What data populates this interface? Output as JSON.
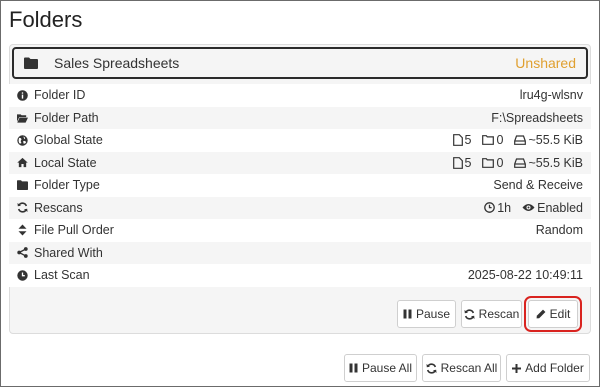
{
  "page": {
    "title": "Folders"
  },
  "folder": {
    "name": "Sales Spreadsheets",
    "status": "Unshared",
    "rows": [
      {
        "label": "Folder ID",
        "value": "lru4g-wlsnv",
        "icon": "info-circle-icon"
      },
      {
        "label": "Folder Path",
        "value": "F:\\Spreadsheets",
        "icon": "folder-open-icon"
      },
      {
        "label": "Global State",
        "icon": "globe-icon",
        "files": "5",
        "dirs": "0",
        "size": "~55.5 KiB"
      },
      {
        "label": "Local State",
        "icon": "home-icon",
        "files": "5",
        "dirs": "0",
        "size": "~55.5 KiB"
      },
      {
        "label": "Folder Type",
        "value": "Send & Receive",
        "icon": "folder-icon"
      },
      {
        "label": "Rescans",
        "icon": "refresh-icon",
        "interval": "1h",
        "watch": "Enabled"
      },
      {
        "label": "File Pull Order",
        "value": "Random",
        "icon": "sort-icon"
      },
      {
        "label": "Shared With",
        "value": "",
        "icon": "share-icon"
      },
      {
        "label": "Last Scan",
        "value": "2025-08-22 10:49:11",
        "icon": "clock-icon"
      }
    ],
    "buttons": {
      "pause": "Pause",
      "rescan": "Rescan",
      "edit": "Edit"
    }
  },
  "footer": {
    "pause_all": "Pause All",
    "rescan_all": "Rescan All",
    "add_folder": "Add Folder"
  },
  "colors": {
    "status": "#e0a030",
    "highlight": "#d9231f"
  }
}
